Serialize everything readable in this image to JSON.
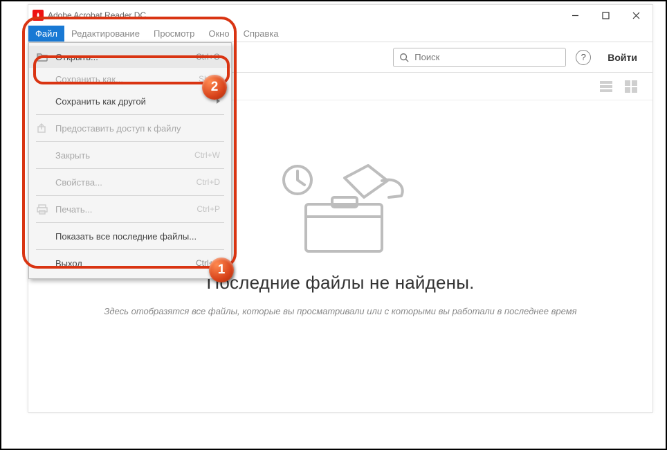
{
  "window": {
    "title": "Adobe Acrobat Reader DC"
  },
  "menubar": {
    "items": [
      "Файл",
      "Редактирование",
      "Просмотр",
      "Окно",
      "Справка"
    ],
    "activeIndex": 0
  },
  "toolbar": {
    "searchPlaceholder": "Поиск",
    "login": "Войти",
    "helpGlyph": "?"
  },
  "dropdown": {
    "items": [
      {
        "type": "item",
        "label": "Открыть...",
        "shortcut": "Ctrl+O",
        "icon": "folder-open-icon",
        "enabled": true,
        "highlighted": true
      },
      {
        "type": "item",
        "label": "Сохранить как...",
        "shortcut": "Shift+",
        "enabled": false
      },
      {
        "type": "item",
        "label": "Сохранить как другой",
        "submenu": true,
        "enabled": true
      },
      {
        "type": "sep"
      },
      {
        "type": "item",
        "label": "Предоставить доступ к файлу",
        "icon": "share-icon",
        "enabled": false
      },
      {
        "type": "sep"
      },
      {
        "type": "item",
        "label": "Закрыть",
        "shortcut": "Ctrl+W",
        "enabled": false
      },
      {
        "type": "sep"
      },
      {
        "type": "item",
        "label": "Свойства...",
        "shortcut": "Ctrl+D",
        "enabled": false
      },
      {
        "type": "sep"
      },
      {
        "type": "item",
        "label": "Печать...",
        "shortcut": "Ctrl+P",
        "icon": "printer-icon",
        "enabled": false
      },
      {
        "type": "sep"
      },
      {
        "type": "item",
        "label": "Показать все последние файлы...",
        "enabled": true
      },
      {
        "type": "sep"
      },
      {
        "type": "item",
        "label": "Выход",
        "shortcut": "Ctrl+Q",
        "enabled": true
      }
    ]
  },
  "main": {
    "headline": "Последние файлы не найдены.",
    "subline": "Здесь отобразятся все файлы, которые вы просматривали или с которыми вы работали в последнее время"
  },
  "badges": {
    "one": "1",
    "two": "2"
  }
}
